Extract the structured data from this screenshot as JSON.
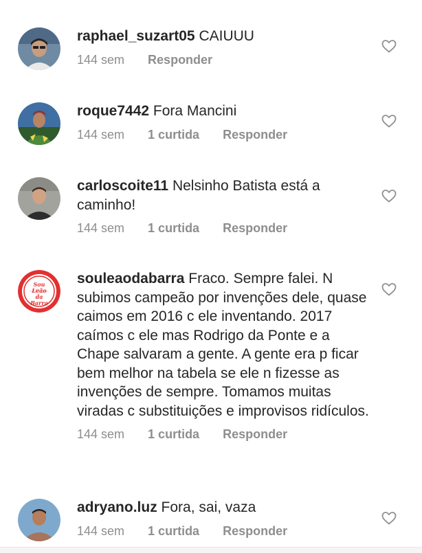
{
  "comments": [
    {
      "username": "raphael_suzart05",
      "text": "CAIUUU",
      "time": "144 sem",
      "likes": "",
      "reply": "Responder",
      "avatar_bg": "#5d7a94"
    },
    {
      "username": "roque7442",
      "text": "Fora Mancini",
      "time": "144 sem",
      "likes": "1 curtida",
      "reply": "Responder",
      "avatar_bg": "#3d6b9c"
    },
    {
      "username": "carloscoite11",
      "text": "Nelsinho Batista está a caminho!",
      "time": "144 sem",
      "likes": "1 curtida",
      "reply": "Responder",
      "avatar_bg": "#9a9a95"
    },
    {
      "username": "souleaodabarra",
      "text": "Fraco. Sempre falei. N subimos campeão por invenções dele, quase caimos em 2016 c ele inventando. 2017 caímos c ele mas Rodrigo da Ponte e a Chape salvaram a gente. A gente era p ficar bem melhor na tabela se ele n fizesse as invenções de sempre. Tomamos muitas viradas c substituições e improvisos ridículos.",
      "time": "144 sem",
      "likes": "1 curtida",
      "reply": "Responder",
      "avatar_bg": "#e02a2a",
      "avatar_logo_text": "Sou Leão da Barra"
    },
    {
      "username": "adryano.luz",
      "text": "Fora, sai, vaza",
      "time": "144 sem",
      "likes": "1 curtida",
      "reply": "Responder",
      "avatar_bg": "#7aa6c9"
    }
  ],
  "icons": {
    "like": "heart-outline-icon"
  },
  "colors": {
    "meta": "#8e8e8e",
    "text": "#262626"
  }
}
